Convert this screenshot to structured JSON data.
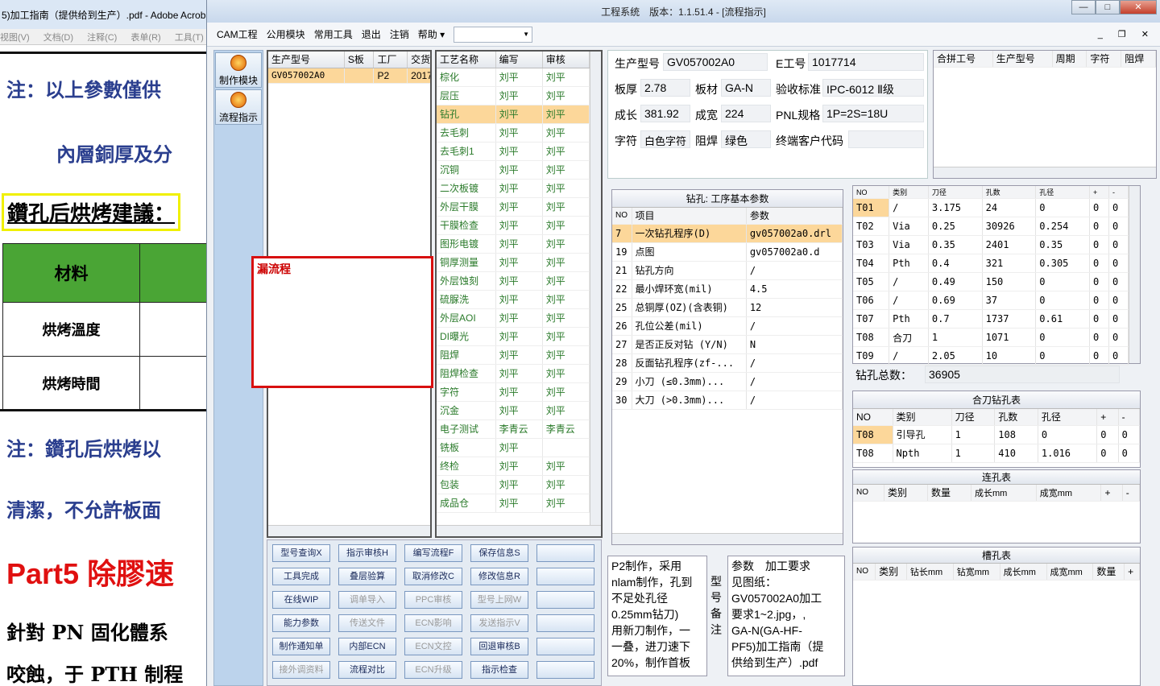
{
  "bg": {
    "title": "5)加工指南（提供给到生产）.pdf - Adobe Acrobat",
    "menu": [
      "视图(V)",
      "文档(D)",
      "注释(C)",
      "表单(R)",
      "工具(T)"
    ],
    "note1": "注：以上參數僅供",
    "note2": "內層銅厚及分",
    "highlight": "鑽孔后烘烤建議：",
    "table_header": "材料",
    "row1": "烘烤溫度",
    "row2": "烘烤時間",
    "note3": "注：鑽孔后烘烤以",
    "note4": "清潔，不允許板面",
    "part5_a": "Part5",
    "part5_b": "除膠速",
    "line1": "針對 PN 固化體系",
    "line2": "咬蝕，于 PTH 制程"
  },
  "window": {
    "title": "工程系统　版本：1.1.51.4 - [流程指示]",
    "menu": [
      "CAM工程",
      "公用模块",
      "常用工具",
      "退出",
      "注销",
      "帮助 ▾"
    ]
  },
  "nav": [
    "制作模块",
    "流程指示"
  ],
  "grid1": {
    "headers": [
      "生产型号",
      "S板",
      "工厂",
      "交货日"
    ],
    "rows": [
      [
        "GV057002A0",
        "",
        "P2",
        "2017/"
      ]
    ]
  },
  "grid2": {
    "headers": [
      "工艺名称",
      "编写",
      "审核"
    ],
    "rows": [
      [
        "棕化",
        "刘平",
        "刘平"
      ],
      [
        "层压",
        "刘平",
        "刘平"
      ],
      [
        "钻孔",
        "刘平",
        "刘平"
      ],
      [
        "去毛刺",
        "刘平",
        "刘平"
      ],
      [
        "去毛刺1",
        "刘平",
        "刘平"
      ],
      [
        "沉铜",
        "刘平",
        "刘平"
      ],
      [
        "二次板镀",
        "刘平",
        "刘平"
      ],
      [
        "外层干膜",
        "刘平",
        "刘平"
      ],
      [
        "干膜检查",
        "刘平",
        "刘平"
      ],
      [
        "图形电镀",
        "刘平",
        "刘平"
      ],
      [
        "铜厚测量",
        "刘平",
        "刘平"
      ],
      [
        "外层蚀刻",
        "刘平",
        "刘平"
      ],
      [
        "硫脲洗",
        "刘平",
        "刘平"
      ],
      [
        "外层AOI",
        "刘平",
        "刘平"
      ],
      [
        "DI曝光",
        "刘平",
        "刘平"
      ],
      [
        "阻焊",
        "刘平",
        "刘平"
      ],
      [
        "阻焊检查",
        "刘平",
        "刘平"
      ],
      [
        "字符",
        "刘平",
        "刘平"
      ],
      [
        "沉金",
        "刘平",
        "刘平"
      ],
      [
        "电子测试",
        "李青云",
        "李青云"
      ],
      [
        "铣板",
        "刘平",
        ""
      ],
      [
        "终检",
        "刘平",
        "刘平"
      ],
      [
        "包装",
        "刘平",
        "刘平"
      ],
      [
        "成品仓",
        "刘平",
        "刘平"
      ]
    ]
  },
  "popup": "漏流程",
  "buttons": [
    [
      "型号查询X",
      "指示审核H",
      "编写流程F",
      "保存信息S",
      ""
    ],
    [
      "工具完成",
      "叠层验算",
      "取消修改C",
      "修改信息R",
      ""
    ],
    [
      "在线WIP",
      "调单导入",
      "PPC审核",
      "型号上网W",
      ""
    ],
    [
      "能力参数",
      "传送文件",
      "ECN影响",
      "发送指示V",
      ""
    ],
    [
      "制作通知单",
      "内部ECN",
      "ECN文控",
      "回退审核B",
      ""
    ],
    [
      "接外调资料",
      "流程对比",
      "ECN升级",
      "指示检查",
      ""
    ]
  ],
  "info": {
    "model_label": "生产型号",
    "model": "GV057002A0",
    "eno_label": "E工号",
    "eno": "1017714",
    "thick_label": "板厚",
    "thick": "2.78",
    "mat_label": "板材",
    "mat": "GA-N",
    "std_label": "验收标准",
    "std": "IPC-6012 Ⅱ级",
    "len_label": "成长",
    "len": "381.92",
    "wid_label": "成宽",
    "wid": "224",
    "pnl_label": "PNL规格",
    "pnl": "1P=2S=18U",
    "char_label": "字符",
    "char": "白色字符",
    "mask_label": "阻焊",
    "mask": "绿色",
    "cust_label": "终端客户代码",
    "cust": ""
  },
  "merge": {
    "headers": [
      "合拼工号",
      "生产型号",
      "周期",
      "字符",
      "阻焊"
    ]
  },
  "params": {
    "title": "钻孔: 工序基本参数",
    "headers": [
      "NO",
      "项目",
      "参数"
    ],
    "rows": [
      [
        "7",
        "一次钻孔程序(D)",
        "gv057002a0.drl"
      ],
      [
        "19",
        "点图",
        "gv057002a0.d"
      ],
      [
        "21",
        "钻孔方向",
        "/"
      ],
      [
        "22",
        "最小焊环宽(mil)",
        "4.5"
      ],
      [
        "25",
        "总铜厚(OZ)(含表铜)",
        "12"
      ],
      [
        "26",
        "孔位公差(mil)",
        "/"
      ],
      [
        "27",
        "是否正反对钻 (Y/N)",
        "N"
      ],
      [
        "28",
        "反面钻孔程序(zf-...",
        "/"
      ],
      [
        "29",
        "小刀 (≤0.3mm)...",
        "/"
      ],
      [
        "30",
        "大刀 (>0.3mm)...",
        "/"
      ]
    ]
  },
  "tools": {
    "headers": [
      "NO",
      "类别",
      "刀径",
      "孔数",
      "孔径",
      "+",
      "-"
    ],
    "rows": [
      [
        "T01",
        "/",
        "3.175",
        "24",
        "0",
        "0",
        "0"
      ],
      [
        "T02",
        "Via",
        "0.25",
        "30926",
        "0.254",
        "0",
        "0"
      ],
      [
        "T03",
        "Via",
        "0.35",
        "2401",
        "0.35",
        "0",
        "0"
      ],
      [
        "T04",
        "Pth",
        "0.4",
        "321",
        "0.305",
        "0",
        "0"
      ],
      [
        "T05",
        "/",
        "0.49",
        "150",
        "0",
        "0",
        "0"
      ],
      [
        "T06",
        "/",
        "0.69",
        "37",
        "0",
        "0",
        "0"
      ],
      [
        "T07",
        "Pth",
        "0.7",
        "1737",
        "0.61",
        "0",
        "0"
      ],
      [
        "T08",
        "合刀",
        "1",
        "1071",
        "0",
        "0",
        "0"
      ],
      [
        "T09",
        "/",
        "2.05",
        "10",
        "0",
        "0",
        "0"
      ]
    ],
    "total_label": "钻孔总数：",
    "total": "36905"
  },
  "combo": {
    "title": "合刀钻孔表",
    "headers": [
      "NO",
      "类别",
      "刀径",
      "孔数",
      "孔径",
      "+",
      "-"
    ],
    "rows": [
      [
        "T08",
        "引导孔",
        "1",
        "108",
        "0",
        "0",
        "0"
      ],
      [
        "T08",
        "Npth",
        "1",
        "410",
        "1.016",
        "0",
        "0"
      ]
    ]
  },
  "link": {
    "title": "连孔表",
    "headers": [
      "NO",
      "类别",
      "数量",
      "成长mm",
      "成宽mm",
      "+",
      "-"
    ]
  },
  "slot": {
    "title": "槽孔表",
    "headers": [
      "NO",
      "类别",
      "钻长mm",
      "钻宽mm",
      "成长mm",
      "成宽mm",
      "数量",
      "+"
    ]
  },
  "remark": {
    "left": "P2制作，采用\nnlam制作，孔到\n不足处孔径\n0.25mm钻刀)\n用新刀制作，一\n一叠，进刀速下\n20%，制作首板",
    "label": "型号备注",
    "right": "参数　加工要求\n见图纸：\nGV057002A0加工\n要求1~2.jpg，,\nGA-N(GA-HF-\nPF5)加工指南（提\n供给到生产）.pdf"
  }
}
